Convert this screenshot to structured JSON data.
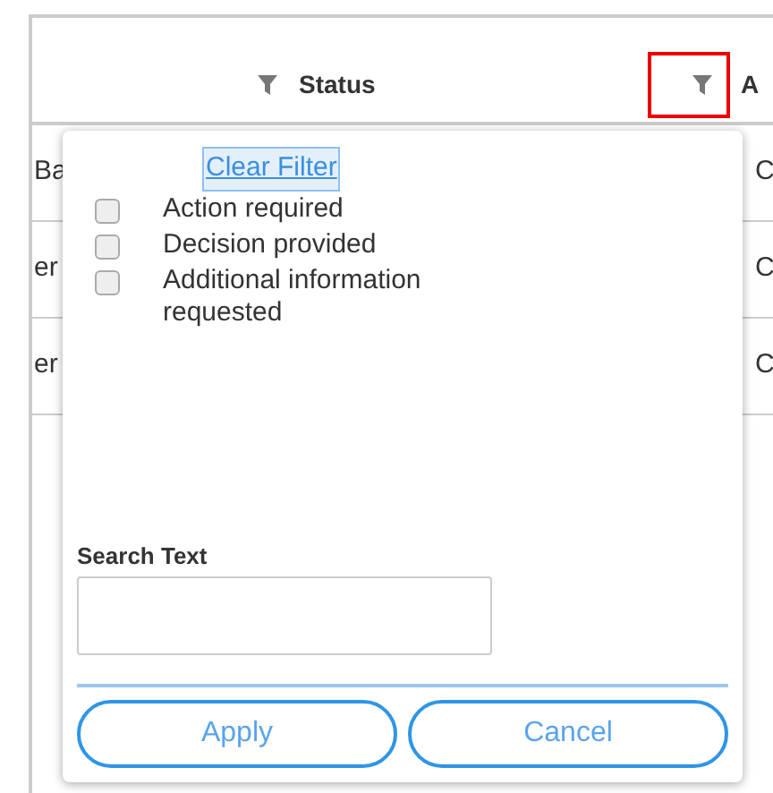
{
  "table": {
    "columns": [
      {
        "label": "Status",
        "highlighted": false
      },
      {
        "label": "A",
        "highlighted": true
      }
    ],
    "rows": [
      {
        "column_1": "Ba",
        "column_3": "C"
      },
      {
        "column_1": "er",
        "column_3": "C"
      },
      {
        "column_1": "er",
        "column_3": "C"
      }
    ]
  },
  "filter_menu": {
    "clear_link": "Clear Filter",
    "options": [
      {
        "label": "Action required",
        "checked": false
      },
      {
        "label": "Decision provided",
        "checked": false
      },
      {
        "label": "Additional information requested",
        "checked": false
      }
    ],
    "search_label": "Search Text",
    "buttons": [
      "Apply",
      "Cancel"
    ]
  }
}
